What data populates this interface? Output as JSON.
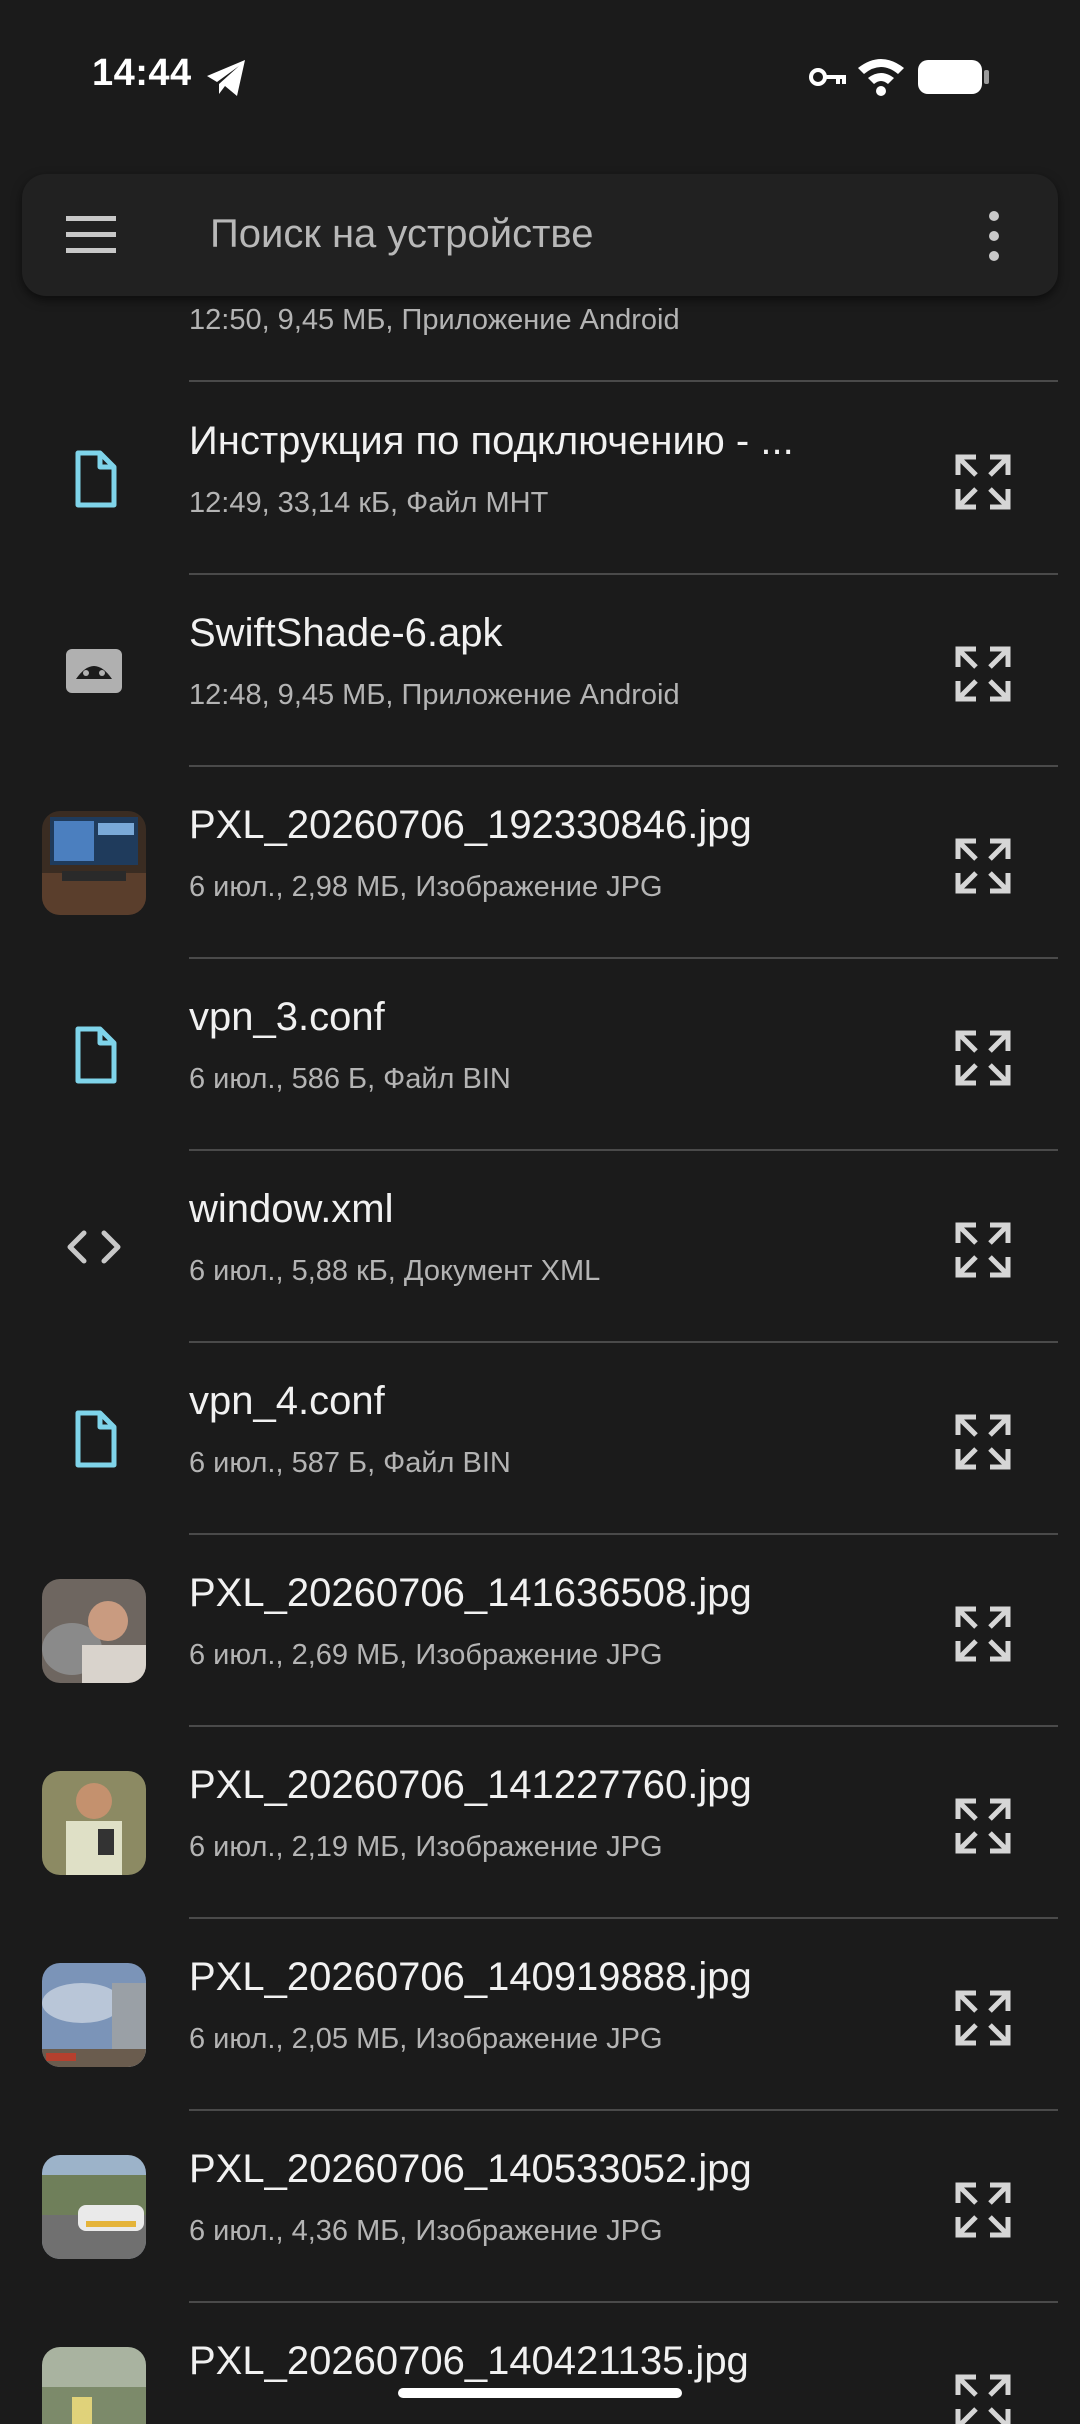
{
  "status_bar": {
    "time": "14:44"
  },
  "search": {
    "placeholder": "Поиск на устройстве"
  },
  "files": [
    {
      "name": "",
      "meta": "12:50, 9,45 МБ, Приложение Android",
      "icon": "android-icon"
    },
    {
      "name": "Инструкция по подключению - ...",
      "meta": "12:49, 33,14 кБ, Файл MHT",
      "icon": "file-icon"
    },
    {
      "name": "SwiftShade-6.apk",
      "meta": "12:48, 9,45 МБ, Приложение Android",
      "icon": "android-icon"
    },
    {
      "name": "PXL_20260706_192330846.jpg",
      "meta": "6 июл., 2,98 МБ, Изображение JPG",
      "icon": "image-thumbnail"
    },
    {
      "name": "vpn_3.conf",
      "meta": "6 июл., 586 Б, Файл BIN",
      "icon": "file-icon"
    },
    {
      "name": "window.xml",
      "meta": "6 июл., 5,88 кБ, Документ XML",
      "icon": "code-icon"
    },
    {
      "name": "vpn_4.conf",
      "meta": "6 июл., 587 Б, Файл BIN",
      "icon": "file-icon"
    },
    {
      "name": "PXL_20260706_141636508.jpg",
      "meta": "6 июл., 2,69 МБ, Изображение JPG",
      "icon": "image-thumbnail"
    },
    {
      "name": "PXL_20260706_141227760.jpg",
      "meta": "6 июл., 2,19 МБ, Изображение JPG",
      "icon": "image-thumbnail"
    },
    {
      "name": "PXL_20260706_140919888.jpg",
      "meta": "6 июл., 2,05 МБ, Изображение JPG",
      "icon": "image-thumbnail"
    },
    {
      "name": "PXL_20260706_140533052.jpg",
      "meta": "6 июл., 4,36 МБ, Изображение JPG",
      "icon": "image-thumbnail"
    },
    {
      "name": "PXL_20260706_140421135.jpg",
      "meta": "",
      "icon": "image-thumbnail"
    }
  ],
  "colors": {
    "background": "#1b1b1b",
    "accent_file_icon": "#7fd4ea",
    "searchbar": "#212121"
  }
}
